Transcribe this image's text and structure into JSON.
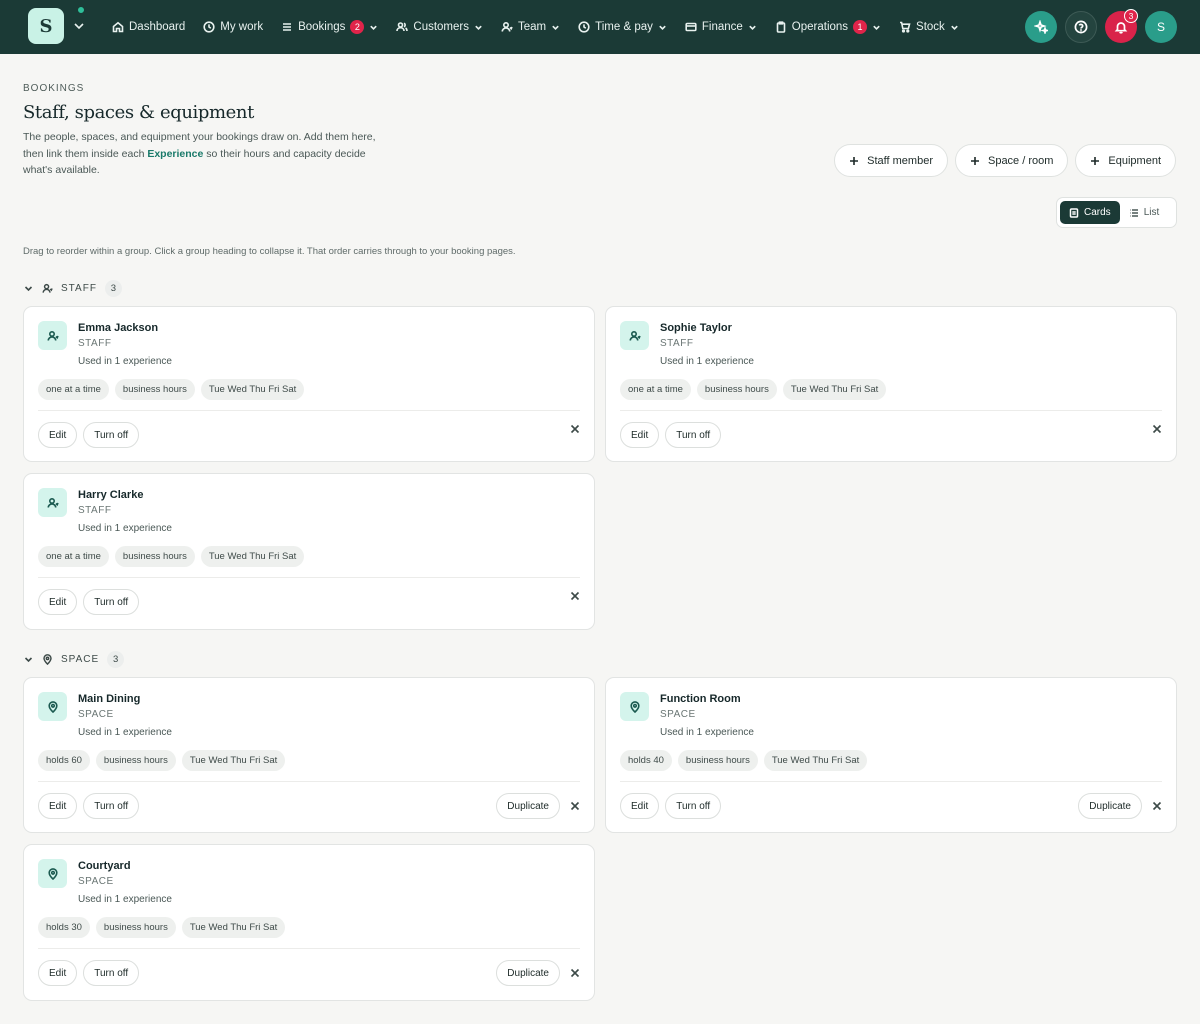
{
  "nav": {
    "logo_letter": "S",
    "items": [
      {
        "label": "Dashboard",
        "icon": "home-icon"
      },
      {
        "label": "My work",
        "icon": "clock-icon"
      },
      {
        "label": "Bookings",
        "icon": "list-icon",
        "badge": "2"
      },
      {
        "label": "Customers",
        "icon": "users-icon"
      },
      {
        "label": "Team",
        "icon": "user-icon"
      },
      {
        "label": "Time & pay",
        "icon": "clock-icon"
      },
      {
        "label": "Finance",
        "icon": "card-icon"
      },
      {
        "label": "Operations",
        "icon": "clipboard-icon",
        "badge": "1"
      },
      {
        "label": "Stock",
        "icon": "cart-icon"
      }
    ],
    "notifications_count": "3",
    "avatar_letter": "S"
  },
  "header": {
    "eyebrow": "BOOKINGS",
    "title": "Staff, spaces & equipment",
    "desc_before": "The people, spaces, and equipment your bookings draw on. Add them here, then link them inside each ",
    "desc_link": "Experience",
    "desc_after": " so their hours and capacity decide what's available."
  },
  "add_buttons": {
    "staff": "Staff member",
    "space": "Space / room",
    "equipment": "Equipment"
  },
  "view_toggle": {
    "cards": "Cards",
    "list": "List",
    "active": "cards"
  },
  "hint": "Drag to reorder within a group. Click a group heading to collapse it. That order carries through to your booking pages.",
  "groups": {
    "staff": {
      "label": "STAFF",
      "count": "3",
      "cards": [
        {
          "name": "Emma Jackson",
          "type": "STAFF",
          "used": "Used in 1 experience",
          "tags": [
            "one at a time",
            "business hours",
            "Tue Wed Thu Fri Sat"
          ]
        },
        {
          "name": "Sophie Taylor",
          "type": "STAFF",
          "used": "Used in 1 experience",
          "tags": [
            "one at a time",
            "business hours",
            "Tue Wed Thu Fri Sat"
          ]
        },
        {
          "name": "Harry Clarke",
          "type": "STAFF",
          "used": "Used in 1 experience",
          "tags": [
            "one at a time",
            "business hours",
            "Tue Wed Thu Fri Sat"
          ]
        }
      ]
    },
    "space": {
      "label": "SPACE",
      "count": "3",
      "cards": [
        {
          "name": "Main Dining",
          "type": "SPACE",
          "used": "Used in 1 experience",
          "tags": [
            "holds 60",
            "business hours",
            "Tue Wed Thu Fri Sat"
          ]
        },
        {
          "name": "Function Room",
          "type": "SPACE",
          "used": "Used in 1 experience",
          "tags": [
            "holds 40",
            "business hours",
            "Tue Wed Thu Fri Sat"
          ]
        },
        {
          "name": "Courtyard",
          "type": "SPACE",
          "used": "Used in 1 experience",
          "tags": [
            "holds 30",
            "business hours",
            "Tue Wed Thu Fri Sat"
          ]
        }
      ]
    }
  },
  "card_actions": {
    "edit": "Edit",
    "turn_off": "Turn off",
    "duplicate": "Duplicate"
  },
  "colors": {
    "nav_bg": "#1b3a36",
    "accent": "#2a9d8a",
    "alert": "#d9234a",
    "icon_tile": "#d4f4ec"
  }
}
